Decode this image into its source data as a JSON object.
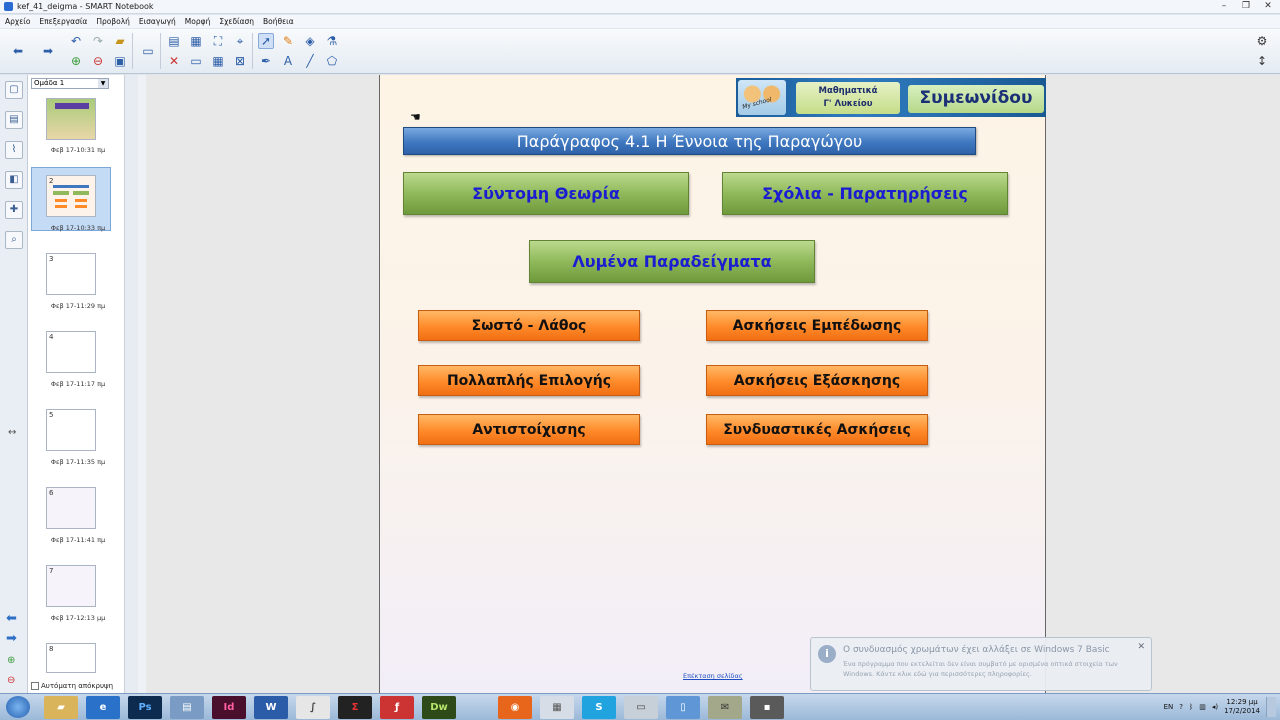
{
  "window": {
    "title": "kef_41_deigma - SMART Notebook"
  },
  "menu": [
    "Αρχείο",
    "Επεξεργασία",
    "Προβολή",
    "Εισαγωγή",
    "Μορφή",
    "Σχεδίαση",
    "Βοήθεια"
  ],
  "sorter": {
    "group": "Ομάδα 1",
    "pages": [
      {
        "num": "",
        "caption": "Φεβ 17-10:31 πμ"
      },
      {
        "num": "2",
        "caption": "Φεβ 17-10:33 πμ"
      },
      {
        "num": "3",
        "caption": "Φεβ 17-11:29 πμ"
      },
      {
        "num": "4",
        "caption": "Φεβ 17-11:17 πμ"
      },
      {
        "num": "5",
        "caption": "Φεβ 17-11:35 πμ"
      },
      {
        "num": "6",
        "caption": "Φεβ 17-11:41 πμ"
      },
      {
        "num": "7",
        "caption": "Φεβ 17-12:13 μμ"
      },
      {
        "num": "8",
        "caption": ""
      }
    ],
    "auto_hide": "Αυτόματη απόκρυψη"
  },
  "page": {
    "banner": {
      "subject_line1": "Μαθηματικά",
      "subject_line2": "Γ' Λυκείου",
      "author": "Συμεωνίδου",
      "tag": "My school"
    },
    "title": "Παράγραφος 4.1  Η Έννοια της Παραγώγου",
    "green_buttons": [
      "Σύντομη Θεωρία",
      "Σχόλια - Παρατηρήσεις",
      "Λυμένα Παραδείγματα"
    ],
    "orange_buttons": [
      "Σωστό - Λάθος",
      "Ασκήσεις Εμπέδωσης",
      "Πολλαπλής Επιλογής",
      "Ασκήσεις Εξάσκησης",
      "Αντιστοίχισης",
      "Συνδυαστικές Ασκήσεις"
    ],
    "extend_link": "Επέκταση σελίδας"
  },
  "notification": {
    "title": "Ο συνδυασμός χρωμάτων έχει αλλάξει σε Windows 7 Basic",
    "body": "Ένα πρόγραμμα που εκτελείται δεν είναι συμβατό με ορισμένα οπτικά στοιχεία των Windows. Κάντε κλικ εδώ για περισσότερες πληροφορίες."
  },
  "taskbar": {
    "lang": "EN",
    "time": "12:29 μμ",
    "date": "17/2/2014",
    "apps": [
      "Ps",
      "Id",
      "W",
      "Dw"
    ]
  },
  "colors": {
    "title_blue": "#3f78c0",
    "green": "#8fb95a",
    "orange": "#ff8a2a",
    "link": "#1a1ed0"
  }
}
